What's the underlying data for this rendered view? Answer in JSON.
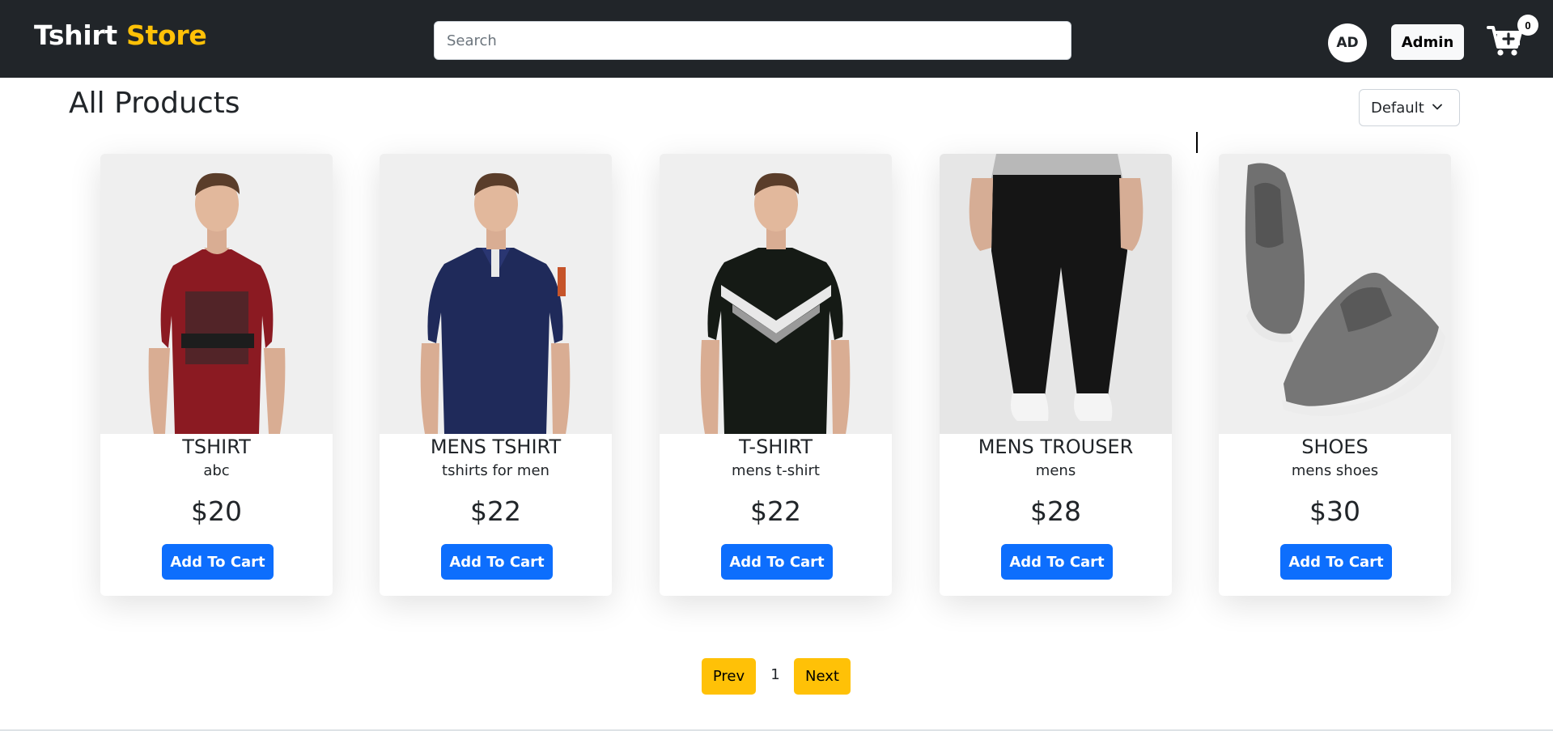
{
  "navbar": {
    "brand_main": "Tshirt",
    "brand_accent": "Store",
    "search_placeholder": "Search",
    "avatar_initials": "AD",
    "admin_label": "Admin",
    "cart_count": "0",
    "cart_icon": "cart-plus-icon"
  },
  "header": {
    "title": "All Products",
    "sort_selected": "Default"
  },
  "products": [
    {
      "name": "TSHIRT",
      "description": "abc",
      "price": "$20",
      "button": "Add To Cart"
    },
    {
      "name": "MENS TSHIRT",
      "description": "tshirts for men",
      "price": "$22",
      "button": "Add To Cart"
    },
    {
      "name": "T-SHIRT",
      "description": "mens t-shirt",
      "price": "$22",
      "button": "Add To Cart"
    },
    {
      "name": "MENS TROUSER",
      "description": "mens",
      "price": "$28",
      "button": "Add To Cart"
    },
    {
      "name": "SHOES",
      "description": "mens shoes",
      "price": "$30",
      "button": "Add To Cart"
    }
  ],
  "pagination": {
    "prev_label": "Prev",
    "current_page": "1",
    "next_label": "Next"
  },
  "colors": {
    "navbar_bg": "#212529",
    "brand_accent": "#ffc107",
    "primary_button": "#0d6efd",
    "pagination_button": "#ffc107"
  }
}
